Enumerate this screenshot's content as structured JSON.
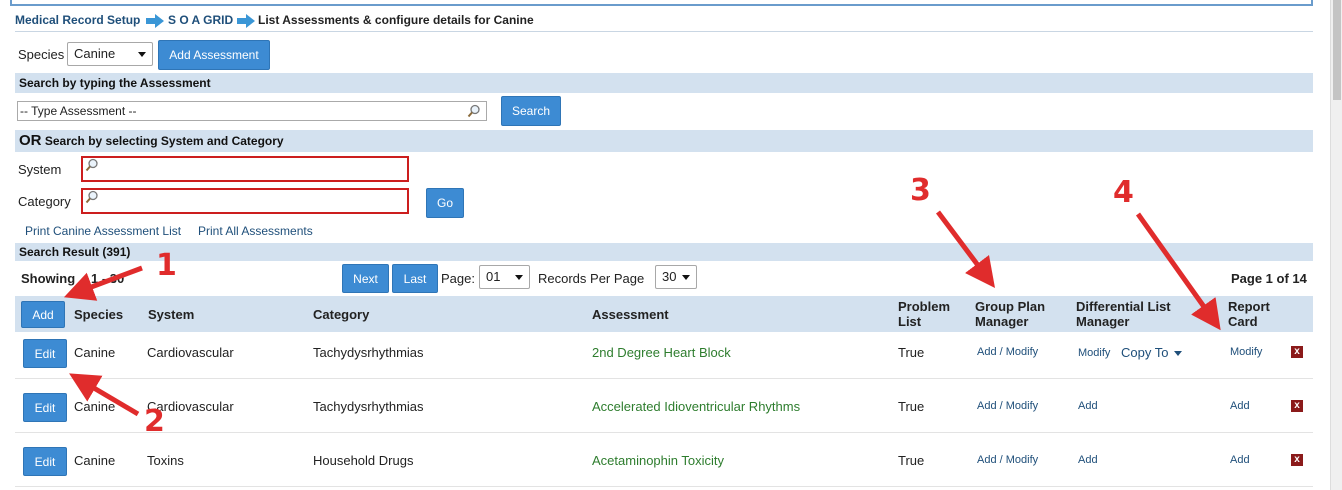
{
  "breadcrumb": {
    "item1": "Medical Record Setup",
    "item2": "S O A GRID",
    "current": "List Assessments & configure details for Canine"
  },
  "species_row": {
    "label": "Species",
    "selected": "Canine",
    "add_button": "Add Assessment"
  },
  "search_type": {
    "header": "Search by typing the Assessment",
    "placeholder": "-- Type Assessment --",
    "button": "Search"
  },
  "search_select": {
    "header_or": "OR",
    "header_rest": "Search by selecting System and Category",
    "system_label": "System",
    "category_label": "Category",
    "go_button": "Go"
  },
  "print_links": {
    "print_list": "Print Canine Assessment List",
    "print_all": "Print All Assessments"
  },
  "results": {
    "header": "Search Result (391)",
    "showing": "Showing",
    "showing_range": "1 - 30",
    "next": "Next",
    "last": "Last",
    "page_label": "Page:",
    "page_value": "01",
    "records_label": "Records Per Page",
    "records_value": "30",
    "page_of": "Page 1 of 14"
  },
  "table": {
    "add_button": "Add",
    "headers": {
      "species": "Species",
      "system": "System",
      "category": "Category",
      "assessment": "Assessment",
      "problem_list_1": "Problem",
      "problem_list_2": "List",
      "group_plan_1": "Group Plan",
      "group_plan_2": "Manager",
      "diff_list_1": "Differential List",
      "diff_list_2": "Manager",
      "report_card_1": "Report",
      "report_card_2": "Card"
    },
    "rows": [
      {
        "edit": "Edit",
        "species": "Canine",
        "system": "Cardiovascular",
        "category": "Tachydysrhythmias",
        "assessment": "2nd Degree Heart Block",
        "problem_list": "True",
        "group_plan": "Add / Modify",
        "diff_list": "Modify",
        "copy_to": "Copy To",
        "report_card": "Modify",
        "delete": "x"
      },
      {
        "edit": "Edit",
        "species": "Canine",
        "system": "Cardiovascular",
        "category": "Tachydysrhythmias",
        "assessment": "Accelerated Idioventricular Rhythms",
        "problem_list": "True",
        "group_plan": "Add / Modify",
        "diff_list": "Add",
        "report_card": "Add",
        "delete": "x"
      },
      {
        "edit": "Edit",
        "species": "Canine",
        "system": "Toxins",
        "category": "Household Drugs",
        "assessment": "Acetaminophin Toxicity",
        "problem_list": "True",
        "group_plan": "Add / Modify",
        "diff_list": "Add",
        "report_card": "Add",
        "delete": "x"
      }
    ]
  },
  "annotations": {
    "n1": "1",
    "n2": "2",
    "n3": "3",
    "n4": "4"
  },
  "colors": {
    "accent_blue": "#3d8bd3",
    "bar_bg": "#d3e1ef",
    "link": "#1f4f7a",
    "assessment_green": "#2e7d2e",
    "annotation_red": "#e02c2c",
    "delete_red": "#8b1a1a"
  }
}
